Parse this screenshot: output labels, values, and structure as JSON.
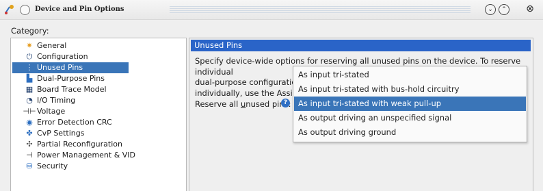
{
  "window": {
    "title": "Device and Pin Options",
    "menu_icon": "circle-menu-icon",
    "buttons": [
      "chevron-down-icon",
      "chevron-up-icon",
      "close-icon"
    ]
  },
  "category_label": "Category:",
  "tree": {
    "items": [
      {
        "label": "General",
        "icon": "sparkle-icon"
      },
      {
        "label": "Configuration",
        "icon": "configuration-icon"
      },
      {
        "label": "Unused Pins",
        "icon": "unused-pins-icon",
        "selected": true
      },
      {
        "label": "Dual-Purpose Pins",
        "icon": "dual-purpose-pins-icon"
      },
      {
        "label": "Board Trace Model",
        "icon": "board-trace-icon"
      },
      {
        "label": "I/O Timing",
        "icon": "clock-icon"
      },
      {
        "label": "Voltage",
        "icon": "voltage-icon"
      },
      {
        "label": "Error Detection CRC",
        "icon": "crc-icon"
      },
      {
        "label": "CvP Settings",
        "icon": "cvp-icon"
      },
      {
        "label": "Partial Reconfiguration",
        "icon": "puzzle-icon"
      },
      {
        "label": "Power Management & VID",
        "icon": "power-icon"
      },
      {
        "label": "Security",
        "icon": "security-icon"
      }
    ]
  },
  "panel": {
    "header": "Unused Pins",
    "desc_line1": "Specify device-wide options for reserving all unused pins on the device. To reserve individual",
    "desc_line2": "dual-purpose configuration",
    "desc_line3": "individually, use the Assignm",
    "reserve_label_pre": "Reserve all ",
    "reserve_label_u": "u",
    "reserve_label_post": "nused pins:",
    "help_icon": "help-icon"
  },
  "dropdown": {
    "options": [
      "As input tri-stated",
      "As input tri-stated with bus-hold circuitry",
      "As input tri-stated with weak pull-up",
      "As output driving an unspecified signal",
      "As output driving ground"
    ],
    "selected_index": 2
  },
  "colors": {
    "header_bg": "#2a64c8",
    "selection_bg": "#3a75b8"
  }
}
